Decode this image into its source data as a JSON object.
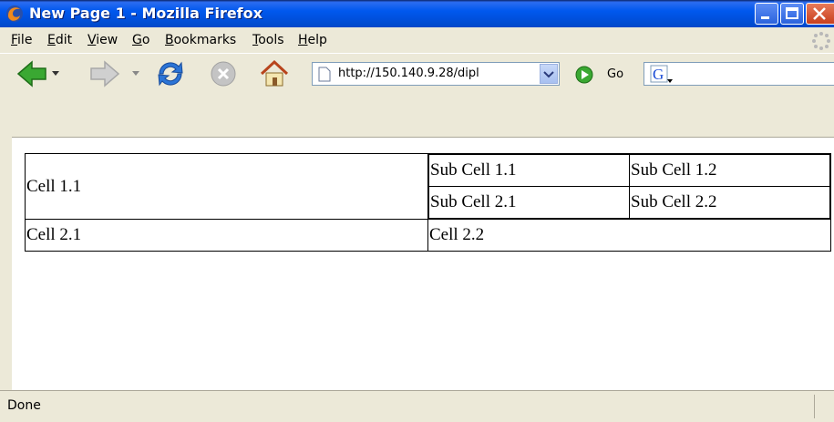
{
  "window": {
    "title": "New Page 1 - Mozilla Firefox"
  },
  "menu": [
    "File",
    "Edit",
    "View",
    "Go",
    "Bookmarks",
    "Tools",
    "Help"
  ],
  "toolbar": {
    "back_icon": "back-arrow-icon",
    "forward_icon": "forward-arrow-icon",
    "reload_icon": "reload-icon",
    "stop_icon": "stop-icon",
    "home_icon": "home-icon",
    "url": "http://150.140.9.28/dipl",
    "go_label": "Go",
    "search_engine_icon": "google-icon"
  },
  "table": {
    "cell_1_1": "Cell 1.1",
    "sub_cells": [
      [
        "Sub Cell 1.1",
        "Sub Cell 1.2"
      ],
      [
        "Sub Cell 2.1",
        "Sub Cell 2.2"
      ]
    ],
    "cell_2_1": "Cell 2.1",
    "cell_2_2": "Cell 2.2"
  },
  "status": {
    "text": "Done"
  },
  "colors": {
    "titlebar": "#0054e3",
    "chrome": "#ece9d8",
    "arrow_green": "#3aa832",
    "reload_blue": "#2b74d6"
  }
}
